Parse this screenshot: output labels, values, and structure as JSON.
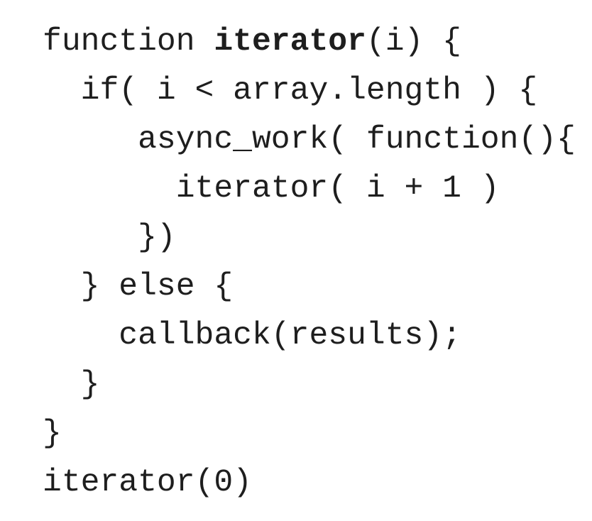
{
  "code": {
    "lines": [
      {
        "indent": 0,
        "parts": [
          {
            "text": "function ",
            "bold": false
          },
          {
            "text": "iterator",
            "bold": true
          },
          {
            "text": "(i) {",
            "bold": false
          }
        ]
      },
      {
        "indent": 2,
        "parts": [
          {
            "text": "if( i < array.length ) {",
            "bold": false
          }
        ]
      },
      {
        "indent": 5,
        "parts": [
          {
            "text": "async_work( function(){",
            "bold": false
          }
        ]
      },
      {
        "indent": 7,
        "parts": [
          {
            "text": "iterator( i + 1 )",
            "bold": false
          }
        ]
      },
      {
        "indent": 5,
        "parts": [
          {
            "text": "})",
            "bold": false
          }
        ]
      },
      {
        "indent": 2,
        "parts": [
          {
            "text": "} else {",
            "bold": false
          }
        ]
      },
      {
        "indent": 4,
        "parts": [
          {
            "text": "callback(results);",
            "bold": false
          }
        ]
      },
      {
        "indent": 2,
        "parts": [
          {
            "text": "}",
            "bold": false
          }
        ]
      },
      {
        "indent": 0,
        "parts": [
          {
            "text": "}",
            "bold": false
          }
        ]
      },
      {
        "indent": 0,
        "parts": [
          {
            "text": "iterator(0)",
            "bold": false
          }
        ]
      }
    ]
  }
}
